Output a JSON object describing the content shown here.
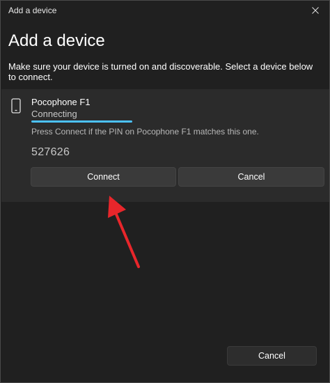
{
  "window": {
    "title": "Add a device"
  },
  "page": {
    "heading": "Add a device",
    "instructions": "Make sure your device is turned on and discoverable. Select a device below to connect."
  },
  "device": {
    "icon": "phone-icon",
    "name": "Pocophone F1",
    "status": "Connecting",
    "pin_message": "Press Connect if the PIN on Pocophone F1 matches this one.",
    "pin": "527626",
    "connect_label": "Connect",
    "cancel_label": "Cancel"
  },
  "footer": {
    "cancel_label": "Cancel"
  },
  "colors": {
    "background": "#202020",
    "card": "#2b2b2b",
    "accent": "#4cc2ff",
    "annotation_arrow": "#e8262b"
  }
}
